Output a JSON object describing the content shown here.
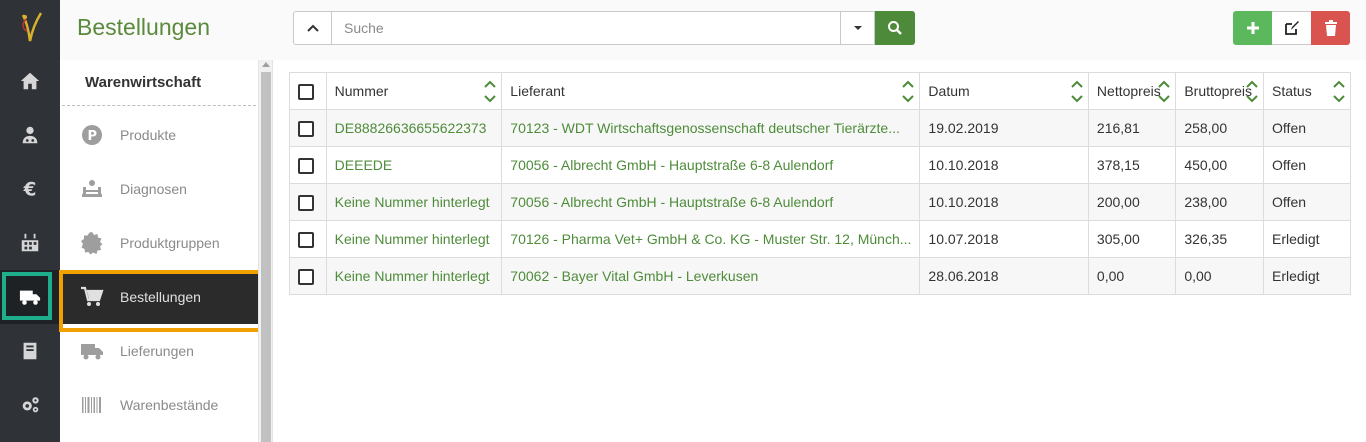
{
  "page": {
    "title": "Bestellungen",
    "accent_color": "#5a8a3c"
  },
  "search": {
    "placeholder": "Suche"
  },
  "rail": {
    "items": [
      "logo-icon",
      "home-icon",
      "patients-icon",
      "euro-icon",
      "calendar-icon",
      "truck-icon",
      "book-icon",
      "settings-icon"
    ],
    "active": "truck-icon"
  },
  "sidebar": {
    "heading": "Warenwirtschaft",
    "items": [
      {
        "label": "Produkte",
        "icon": "product-p-icon"
      },
      {
        "label": "Diagnosen",
        "icon": "diagnosis-icon"
      },
      {
        "label": "Produktgruppen",
        "icon": "gear-group-icon"
      },
      {
        "label": "Bestellungen",
        "icon": "cart-icon",
        "active": true
      },
      {
        "label": "Lieferungen",
        "icon": "truck-icon"
      },
      {
        "label": "Warenbestände",
        "icon": "barcode-icon"
      }
    ]
  },
  "table": {
    "columns": [
      "Nummer",
      "Lieferant",
      "Datum",
      "Nettopreis",
      "Bruttopreis",
      "Status"
    ],
    "rows": [
      {
        "nummer": "DE88826636655622373",
        "lieferant": "70123 - WDT Wirtschaftsgenossenschaft deutscher Tierärzte...",
        "datum": "19.02.2019",
        "netto": "216,81",
        "brutto": "258,00",
        "status": "Offen"
      },
      {
        "nummer": "DEEEDE",
        "lieferant": "70056 - Albrecht GmbH - Hauptstraße 6-8 Aulendorf",
        "datum": "10.10.2018",
        "netto": "378,15",
        "brutto": "450,00",
        "status": "Offen"
      },
      {
        "nummer": "Keine Nummer hinterlegt",
        "lieferant": "70056 - Albrecht GmbH - Hauptstraße 6-8 Aulendorf",
        "datum": "10.10.2018",
        "netto": "200,00",
        "brutto": "238,00",
        "status": "Offen"
      },
      {
        "nummer": "Keine Nummer hinterlegt",
        "lieferant": "70126 - Pharma Vet+ GmbH & Co. KG - Muster Str. 12, Münch...",
        "datum": "10.07.2018",
        "netto": "305,00",
        "brutto": "326,35",
        "status": "Erledigt"
      },
      {
        "nummer": "Keine Nummer hinterlegt",
        "lieferant": "70062 - Bayer Vital GmbH - Leverkusen",
        "datum": "28.06.2018",
        "netto": "0,00",
        "brutto": "0,00",
        "status": "Erledigt"
      }
    ]
  }
}
